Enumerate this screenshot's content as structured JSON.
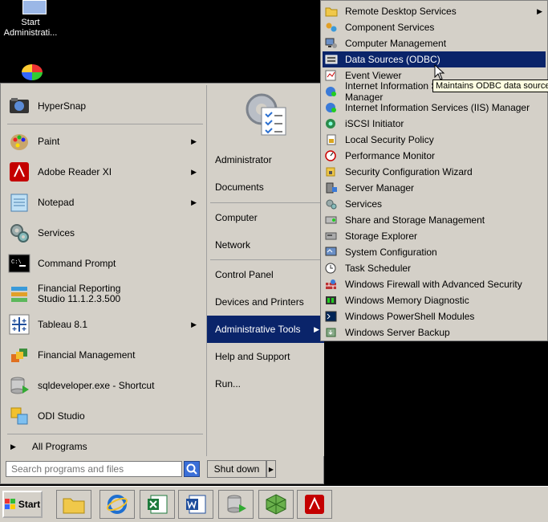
{
  "desktop": {
    "icon1_label": "Start\nAdministrati..."
  },
  "start_menu": {
    "pinned": [
      {
        "label": "HyperSnap",
        "icon": "hypersnap-icon"
      }
    ],
    "programs": [
      {
        "label": "Paint",
        "icon": "paint-icon",
        "arrow": true
      },
      {
        "label": "Adobe Reader XI",
        "icon": "adobe-reader-icon",
        "arrow": true
      },
      {
        "label": "Notepad",
        "icon": "notepad-icon",
        "arrow": true
      },
      {
        "label": "Services",
        "icon": "services-icon",
        "arrow": false
      },
      {
        "label": "Command Prompt",
        "icon": "command-prompt-icon",
        "arrow": false
      },
      {
        "label": "Financial Reporting Studio 11.1.2.3.500",
        "icon": "financial-reporting-icon",
        "arrow": false
      },
      {
        "label": "Tableau 8.1",
        "icon": "tableau-icon",
        "arrow": true
      },
      {
        "label": "Financial Management",
        "icon": "financial-management-icon",
        "arrow": false
      },
      {
        "label": "sqldeveloper.exe - Shortcut",
        "icon": "sqldeveloper-icon",
        "arrow": false
      },
      {
        "label": "ODI Studio",
        "icon": "odi-studio-icon",
        "arrow": false
      }
    ],
    "all_programs": "All Programs",
    "search_placeholder": "Search programs and files",
    "right": [
      {
        "label": "Administrator"
      },
      {
        "label": "Documents"
      },
      {
        "label": "Computer"
      },
      {
        "label": "Network"
      },
      {
        "label": "Control Panel"
      },
      {
        "label": "Devices and Printers"
      },
      {
        "label": "Administrative Tools",
        "arrow": true
      },
      {
        "label": "Help and Support"
      },
      {
        "label": "Run..."
      }
    ],
    "shutdown_label": "Shut down"
  },
  "submenu": {
    "items": [
      {
        "label": "Remote Desktop Services",
        "icon": "folder-icon",
        "arrow": true
      },
      {
        "label": "Component Services",
        "icon": "component-services-icon"
      },
      {
        "label": "Computer Management",
        "icon": "computer-management-icon"
      },
      {
        "label": "Data Sources (ODBC)",
        "icon": "odbc-icon"
      },
      {
        "label": "Event Viewer",
        "icon": "event-viewer-icon"
      },
      {
        "label": "Internet Information Services (IIS) 6.0 Manager",
        "icon": "iis6-icon"
      },
      {
        "label": "Internet Information Services (IIS) Manager",
        "icon": "iis-icon"
      },
      {
        "label": "iSCSI Initiator",
        "icon": "iscsi-icon"
      },
      {
        "label": "Local Security Policy",
        "icon": "security-policy-icon"
      },
      {
        "label": "Performance Monitor",
        "icon": "performance-icon"
      },
      {
        "label": "Security Configuration Wizard",
        "icon": "security-wizard-icon"
      },
      {
        "label": "Server Manager",
        "icon": "server-manager-icon"
      },
      {
        "label": "Services",
        "icon": "services-icon"
      },
      {
        "label": "Share and Storage Management",
        "icon": "share-storage-icon"
      },
      {
        "label": "Storage Explorer",
        "icon": "storage-explorer-icon"
      },
      {
        "label": "System Configuration",
        "icon": "system-config-icon"
      },
      {
        "label": "Task Scheduler",
        "icon": "task-scheduler-icon"
      },
      {
        "label": "Windows Firewall with Advanced Security",
        "icon": "firewall-icon"
      },
      {
        "label": "Windows Memory Diagnostic",
        "icon": "memory-diagnostic-icon"
      },
      {
        "label": "Windows PowerShell Modules",
        "icon": "powershell-icon"
      },
      {
        "label": "Windows Server Backup",
        "icon": "backup-icon"
      }
    ],
    "tooltip": "Maintains ODBC data sources"
  },
  "taskbar": {
    "start_label": "Start",
    "icons": [
      "explorer-icon",
      "ie-icon",
      "excel-icon",
      "word-icon",
      "sqldeveloper-icon",
      "odi-icon",
      "adobe-icon"
    ]
  }
}
